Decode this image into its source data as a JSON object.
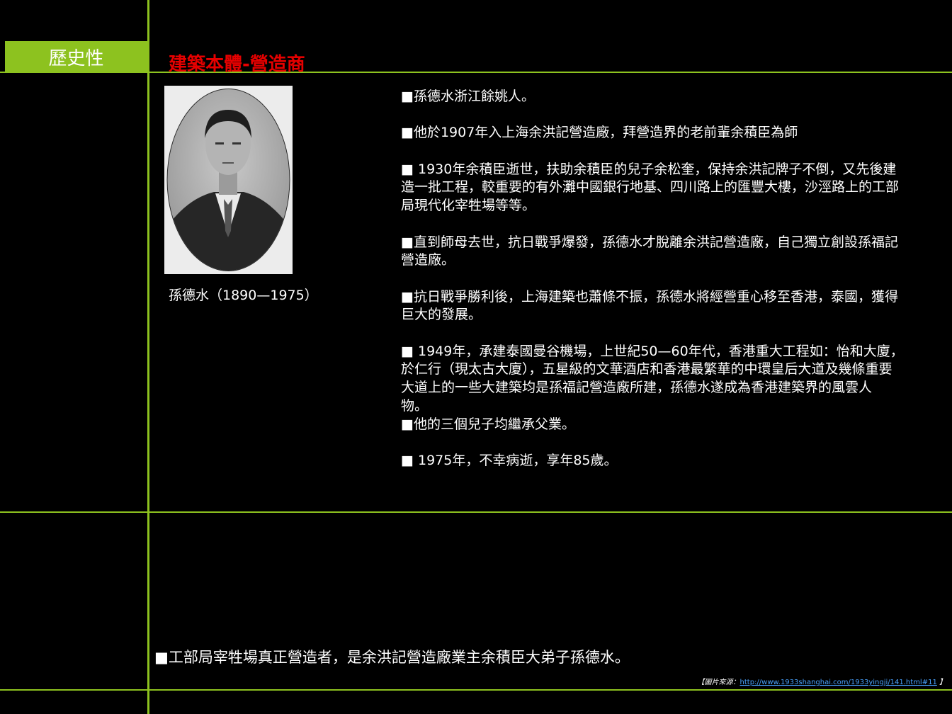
{
  "sidebar": {
    "tag_label": "歷史性"
  },
  "header": {
    "title": "建築本體-營造商"
  },
  "photo": {
    "caption": "孫德水（1890—1975）"
  },
  "content": {
    "paragraphs": [
      {
        "lines": [
          "■孫德水浙江餘姚人。"
        ]
      },
      {
        "lines": [
          "■他於1907年入上海余洪記營造廠，拜營造界的老前輩余積臣為師"
        ]
      },
      {
        "lines": [
          "■ 1930年余積臣逝世，扶助余積臣的兒子余松奎，保持余洪記牌子不倒，又先後建",
          "造一批工程，較重要的有外灘中國銀行地基、四川路上的匯豐大樓，沙涇路上的工部",
          "局現代化宰牲場等等。"
        ]
      },
      {
        "lines": [
          "■直到師母去世，抗日戰爭爆發，孫德水才脫離余洪記營造廠，自己獨立創設孫福記",
          "營造廠。"
        ]
      },
      {
        "lines": [
          "■抗日戰爭勝利後，上海建築也蕭條不振，孫德水將經營重心移至香港，泰國，獲得",
          "巨大的發展。"
        ]
      },
      {
        "lines": [
          "■ 1949年，承建泰國曼谷機場，上世紀50—60年代，香港重大工程如：怡和大廈，",
          "於仁行（現太古大廈），五星級的文華酒店和香港最繁華的中環皇后大道及幾條重要",
          "大道上的一些大建築均是孫福記營造廠所建，孫德水遂成為香港建築界的風雲人",
          "物。",
          "■他的三個兒子均繼承父業。"
        ]
      },
      {
        "lines": [
          "■ 1975年，不幸病逝，享年85歲。"
        ]
      }
    ]
  },
  "footer": {
    "note": "■工部局宰牲場真正營造者，是余洪記營造廠業主余積臣大弟子孫德水。",
    "source_prefix": "【圖片來源：",
    "source_link": "http://www.1933shanghai.com/1933yingji/141.html#11",
    "source_suffix": "】"
  }
}
